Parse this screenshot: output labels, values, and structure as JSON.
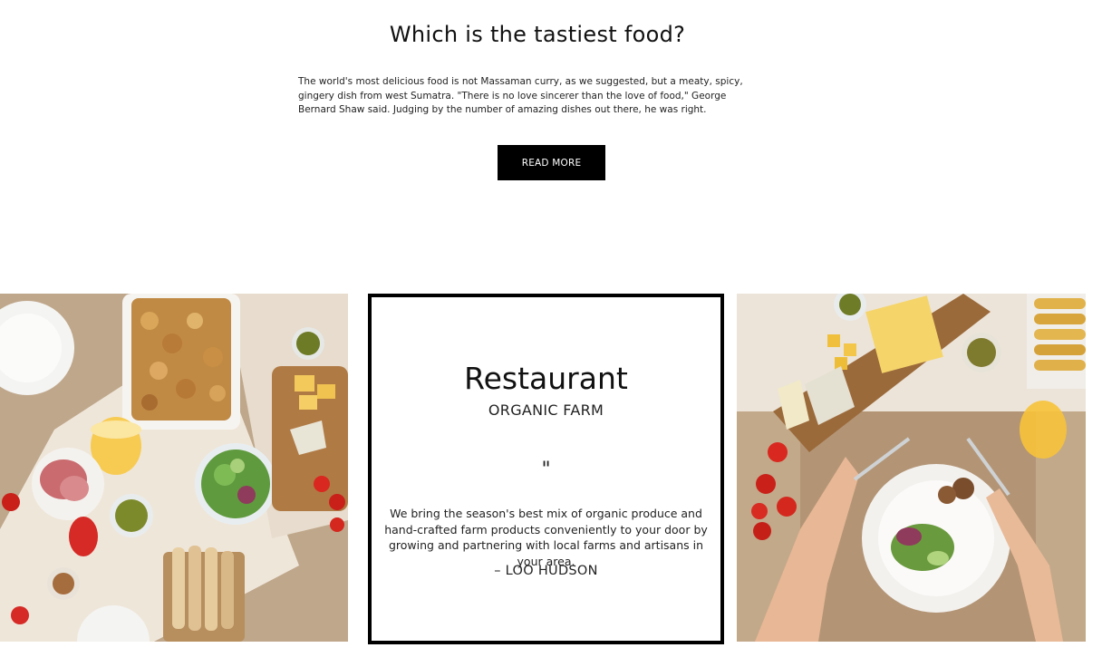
{
  "hero": {
    "title": "Which is the tastiest food?",
    "text": "The world's most delicious food is not Massaman curry, as we suggested, but a meaty, spicy, gingery dish from west Sumatra. \"There is no love sincerer than the love of food,\" George Bernard Shaw said. Judging by the number of amazing dishes out there, he was right.",
    "button_label": "READ MORE"
  },
  "testimonial": {
    "title": "Restaurant",
    "subtitle": "ORGANIC FARM",
    "quote_mark": "\"",
    "text": "We bring the season's best mix of organic produce and hand-crafted farm products conveniently to your door by growing and partnering with local farms and artisans in your area.",
    "author": "– LOO HUDSON"
  },
  "icons": {
    "quote": "quote-icon"
  }
}
